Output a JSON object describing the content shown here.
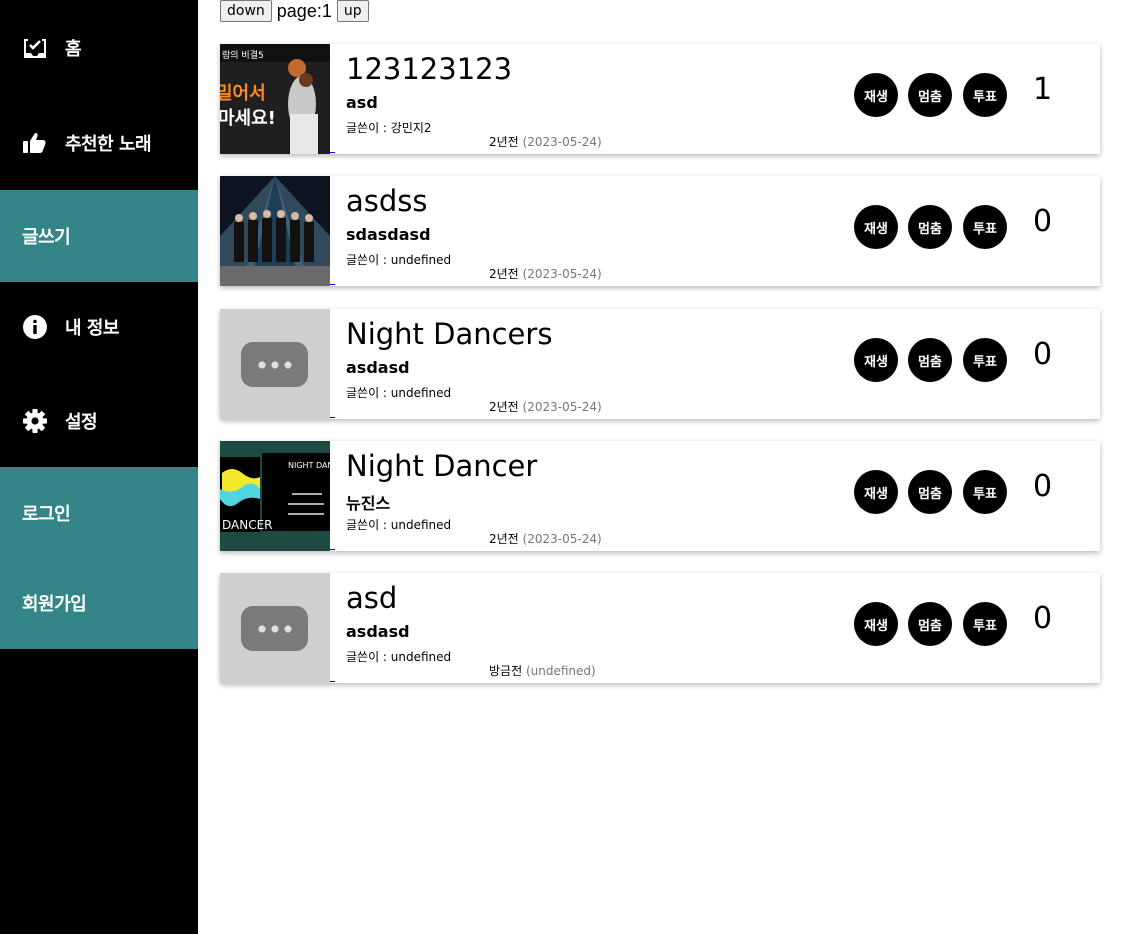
{
  "sidebar": {
    "items": [
      {
        "label": "홈",
        "icon": "inbox-check-icon"
      },
      {
        "label": "추천한 노래",
        "icon": "thumbs-up-icon"
      },
      {
        "label": "글쓰기",
        "icon": ""
      },
      {
        "label": "내 정보",
        "icon": "info-circle-icon"
      },
      {
        "label": "설정",
        "icon": "gear-icon"
      },
      {
        "label": "로그인",
        "icon": ""
      },
      {
        "label": "회원가입",
        "icon": ""
      }
    ],
    "accent_color": "#348587"
  },
  "pager": {
    "down_label": "down",
    "page_text": "page:1",
    "up_label": "up"
  },
  "posts": [
    {
      "thumb_text_1": "람의 비결5",
      "thumb_text_2": "밀어서",
      "thumb_text_3": "마세요!",
      "title": "123123123",
      "artist": "asd",
      "author": "글쓴이 : 강민지2",
      "date_relative": "2년전",
      "date_paren": "(2023-05-24)",
      "play_label": "재생",
      "stop_label": "멈춤",
      "vote_label": "투표",
      "votes": "1"
    },
    {
      "title": "asdss",
      "artist": "sdasdasd",
      "author": "글쓴이 : undefined",
      "date_relative": "2년전",
      "date_paren": "(2023-05-24)",
      "play_label": "재생",
      "stop_label": "멈춤",
      "vote_label": "투표",
      "votes": "0"
    },
    {
      "title": "Night Dancers",
      "artist": "asdasd",
      "author": "글쓴이 : undefined",
      "date_relative": "2년전",
      "date_paren": "(2023-05-24)",
      "play_label": "재생",
      "stop_label": "멈춤",
      "vote_label": "투표",
      "votes": "0"
    },
    {
      "thumb_text_1": "NIGHT DAN",
      "thumb_text_2": "DANCER",
      "title": "Night Dancer",
      "artist": "뉴진스",
      "author": "글쓴이 : undefined",
      "date_relative": "2년전",
      "date_paren": "(2023-05-24)",
      "play_label": "재생",
      "stop_label": "멈춤",
      "vote_label": "투표",
      "votes": "0"
    },
    {
      "title": "asd",
      "artist": "asdasd",
      "author": "글쓴이 : undefined",
      "date_relative": "방금전",
      "date_paren": "(undefined)",
      "play_label": "재생",
      "stop_label": "멈춤",
      "vote_label": "투표",
      "votes": "0"
    }
  ]
}
